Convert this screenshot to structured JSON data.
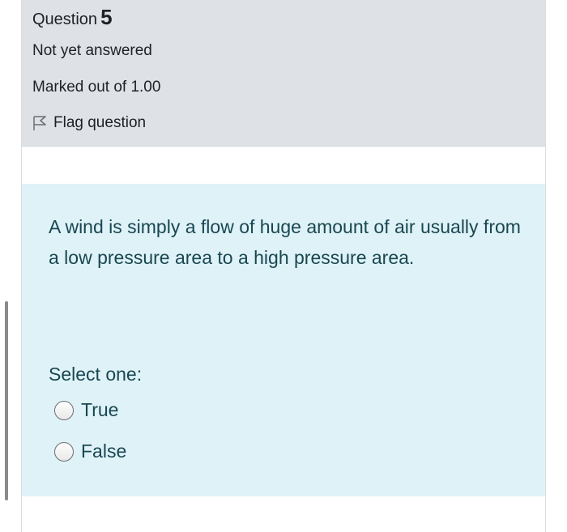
{
  "question_info": {
    "label": "Question",
    "number": "5",
    "state": "Not yet answered",
    "grade": "Marked out of 1.00",
    "flag_label": "Flag question"
  },
  "question": {
    "text": "A wind is simply a flow of huge amount of air usually from a low pressure area to a high pressure area.",
    "prompt": "Select one:",
    "options": [
      {
        "label": "True",
        "selected": false
      },
      {
        "label": "False",
        "selected": false
      }
    ]
  },
  "colors": {
    "info_bg": "#dee2e6",
    "formulation_bg": "#def2f8",
    "formulation_text": "#1a4750"
  }
}
